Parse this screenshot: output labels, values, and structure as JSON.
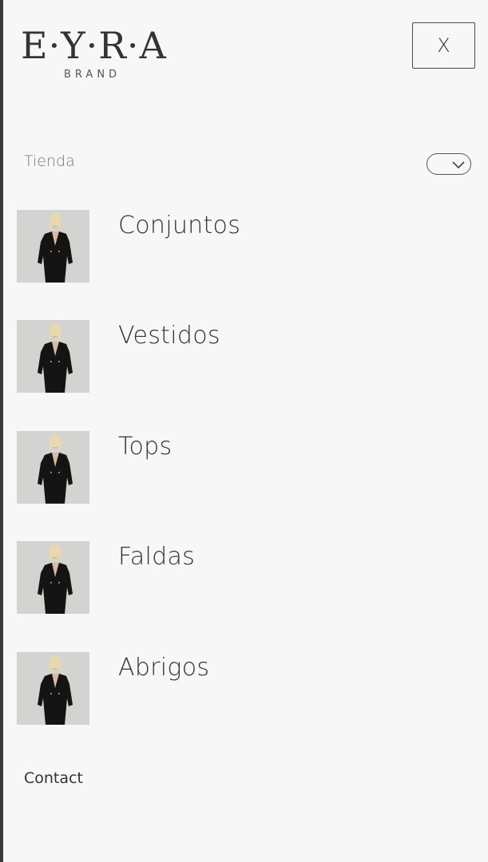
{
  "brand": {
    "name": "E·Y·R·A",
    "sub": "BRAND"
  },
  "close_label": "X",
  "section": {
    "label": "Tienda"
  },
  "categories": [
    {
      "label": "Conjuntos"
    },
    {
      "label": "Vestidos"
    },
    {
      "label": "Tops"
    },
    {
      "label": "Faldas"
    },
    {
      "label": "Abrigos"
    }
  ],
  "contact_label": "Contact",
  "icons": {
    "toggle": "chevron-down-icon",
    "close": "close-icon"
  },
  "colors": {
    "background": "#f7f7f7",
    "text": "#333333",
    "muted": "#777777"
  }
}
